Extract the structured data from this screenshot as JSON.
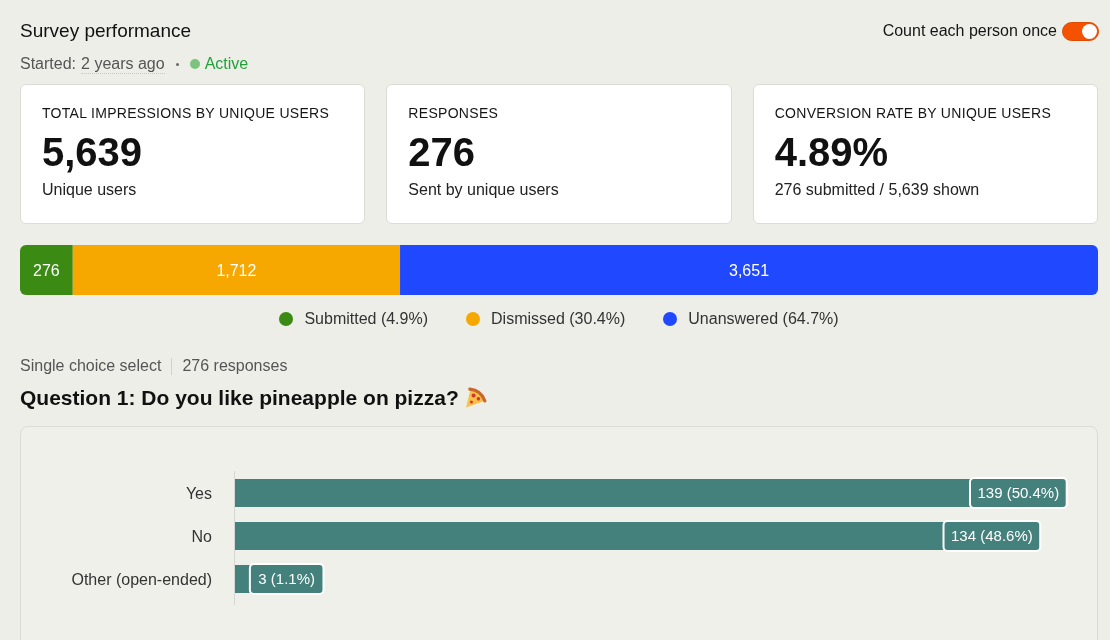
{
  "header": {
    "title": "Survey performance",
    "started_label": "Started:",
    "started_value": "2 years ago",
    "status": {
      "label": "Active",
      "kind": "active"
    }
  },
  "count_toggle": {
    "label": "Count each person once",
    "on": true
  },
  "stat_cards": [
    {
      "label": "TOTAL IMPRESSIONS BY UNIQUE USERS",
      "value": "5,639",
      "caption": "Unique users"
    },
    {
      "label": "RESPONSES",
      "value": "276",
      "caption": "Sent by unique users"
    },
    {
      "label": "CONVERSION RATE BY UNIQUE USERS",
      "value": "4.89%",
      "caption": "276 submitted / 5,639 shown"
    }
  ],
  "response_breakdown": {
    "chart_data": {
      "type": "bar",
      "orientation": "horizontal",
      "stacked": true,
      "legend": "bottom",
      "series": [
        {
          "name": "Submitted (4.9%)",
          "color": "#3b8a13",
          "values": [
            276
          ],
          "value_labels": [
            "276"
          ]
        },
        {
          "name": "Dismissed (30.4%)",
          "color": "#f6a800",
          "values": [
            1712
          ],
          "value_labels": [
            "1,712"
          ]
        },
        {
          "name": "Unanswered (64.7%)",
          "color": "#1f48ff",
          "values": [
            3651
          ],
          "value_labels": [
            "3,651"
          ]
        }
      ]
    }
  },
  "question": {
    "type": "Single choice select",
    "responses": "276 responses",
    "title": "Question 1: Do you like pineapple on pizza?",
    "chart_data": {
      "type": "bar",
      "orientation": "horizontal",
      "categories": [
        "Yes",
        "No",
        "Other (open-ended)"
      ],
      "values": [
        139,
        134,
        3
      ],
      "value_labels": [
        "139 (50.4%)",
        "134 (48.6%)",
        "3 (1.1%)"
      ]
    }
  }
}
